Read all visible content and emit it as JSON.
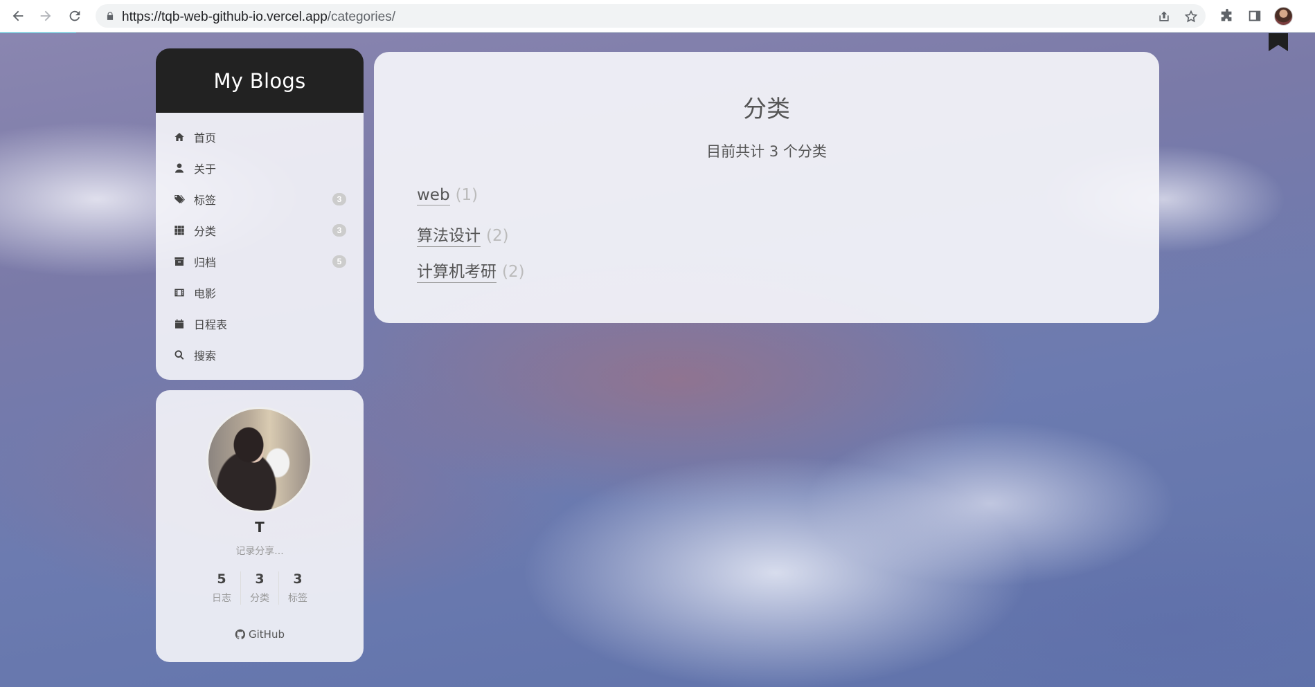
{
  "browser": {
    "url_host": "https://tqb-web-github-io.vercel.app",
    "url_path": "/categories/"
  },
  "colors": {
    "progress": "#32c6e2",
    "brand_bg": "#222222",
    "badge_bg": "#cccccc"
  },
  "sidebar": {
    "brand_title": "My Blogs",
    "menu": [
      {
        "label": "首页",
        "icon": "home-icon"
      },
      {
        "label": "关于",
        "icon": "user-icon"
      },
      {
        "label": "标签",
        "icon": "tags-icon",
        "badge": "3"
      },
      {
        "label": "分类",
        "icon": "grid-icon",
        "badge": "3"
      },
      {
        "label": "归档",
        "icon": "archive-icon",
        "badge": "5"
      },
      {
        "label": "电影",
        "icon": "film-icon"
      },
      {
        "label": "日程表",
        "icon": "calendar-icon"
      },
      {
        "label": "搜索",
        "icon": "search-icon"
      }
    ]
  },
  "profile": {
    "name": "T",
    "description": "记录分享...",
    "stats": [
      {
        "count": "5",
        "label": "日志"
      },
      {
        "count": "3",
        "label": "分类"
      },
      {
        "count": "3",
        "label": "标签"
      }
    ],
    "github_label": "GitHub"
  },
  "main": {
    "title": "分类",
    "summary": "目前共计 3 个分类",
    "categories": [
      {
        "name": "web",
        "count": "(1)"
      },
      {
        "name": "算法设计",
        "count": "(2)"
      },
      {
        "name": "计算机考研",
        "count": "(2)"
      }
    ]
  }
}
